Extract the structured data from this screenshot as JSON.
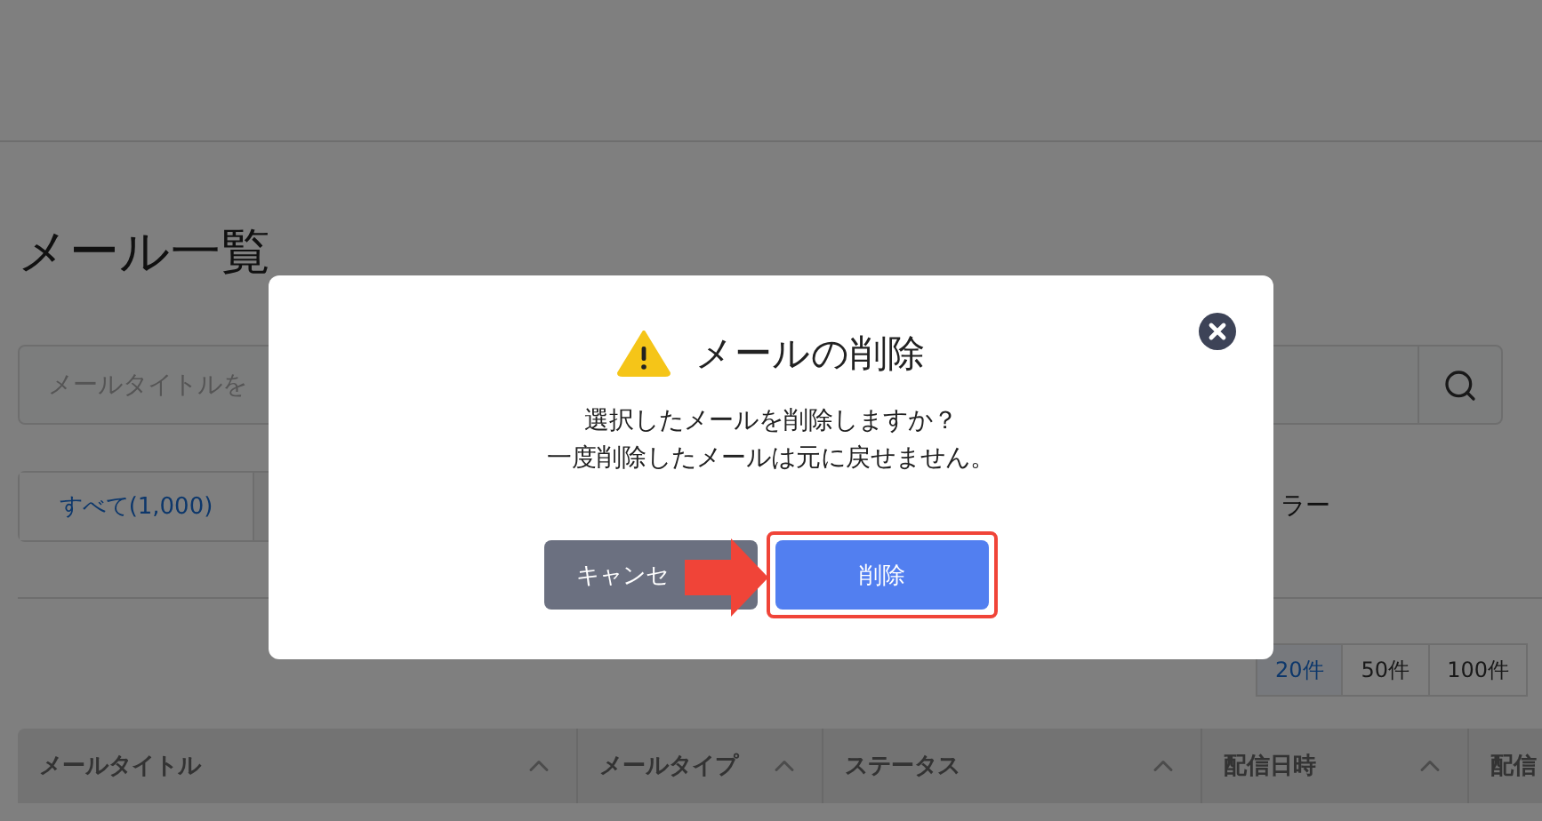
{
  "page": {
    "title": "メール一覧",
    "search": {
      "placeholder": "メールタイトルを"
    },
    "tabs": [
      {
        "label": "すべて(1,000)",
        "selected": true
      }
    ],
    "filter_text": "ラー",
    "page_sizes": [
      {
        "label": "20件",
        "selected": true
      },
      {
        "label": "50件",
        "selected": false
      },
      {
        "label": "100件",
        "selected": false
      }
    ],
    "table": {
      "columns": [
        {
          "label": "メールタイトル",
          "sortable": true
        },
        {
          "label": "メールタイプ",
          "sortable": true
        },
        {
          "label": "ステータス",
          "sortable": true
        },
        {
          "label": "配信日時",
          "sortable": true
        },
        {
          "label": "配信"
        }
      ]
    }
  },
  "dialog": {
    "title": "メールの削除",
    "message": [
      "選択したメールを削除しますか？",
      "一度削除したメールは元に戻せません。"
    ],
    "buttons": [
      {
        "label": "キャンセ",
        "kind": "secondary",
        "highlighted": false
      },
      {
        "label": "削除",
        "kind": "primary",
        "highlighted": true
      }
    ]
  }
}
